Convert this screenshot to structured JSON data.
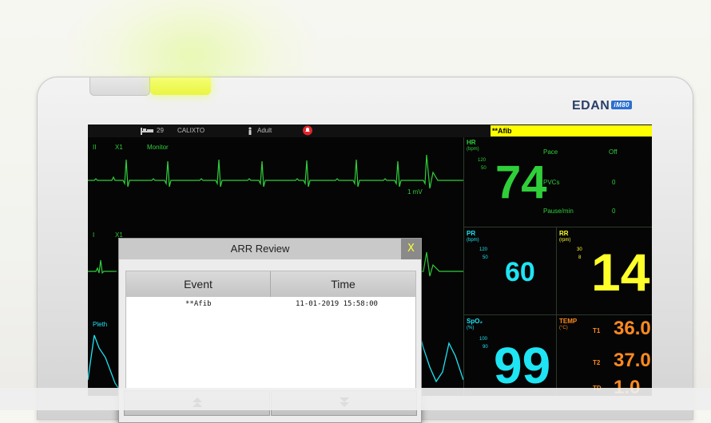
{
  "brand": {
    "name": "EDAN",
    "model": "iM80"
  },
  "topbar": {
    "bed_number": "29",
    "patient_name": "CALIXTO",
    "patient_type": "Adult",
    "alarm_text": "**Afib"
  },
  "waves": {
    "ecg1_lead": "II",
    "ecg1_gain": "X1",
    "ecg1_mode": "Monitor",
    "ecg1_scale": "1 mV",
    "ecg2_lead": "I",
    "ecg2_gain": "X1",
    "pleth_label": "Pleth"
  },
  "hr": {
    "label": "HR",
    "unit": "(bpm)",
    "limit_high": "120",
    "limit_low": "50",
    "value": "74",
    "pace_label": "Pace",
    "pace_value": "Off",
    "pvcs_label": "PVCs",
    "pvcs_value": "0",
    "pause_label": "Pause/min",
    "pause_value": "0"
  },
  "pr": {
    "label": "PR",
    "unit": "(bpm)",
    "limit_high": "120",
    "limit_low": "50",
    "value": "60"
  },
  "rr": {
    "label": "RR",
    "unit": "(rpm)",
    "limit_high": "30",
    "limit_low": "8",
    "value": "14"
  },
  "spo2": {
    "label": "SpO₂",
    "unit": "(%)",
    "limit_high": "100",
    "limit_low": "90",
    "value": "99"
  },
  "temp": {
    "label": "TEMP",
    "unit": "(°C)",
    "t1_label": "T1",
    "t1_value": "36.0",
    "t2_label": "T2",
    "t2_value": "37.0",
    "td_label": "TD",
    "td_value": "1.0"
  },
  "dialog": {
    "title": "ARR Review",
    "close_label": "X",
    "columns": [
      "Event",
      "Time"
    ],
    "rows": [
      {
        "event": "**Afib",
        "time": "11-01-2019 15:58:00"
      }
    ],
    "page_up_icon": "double-up-arrow",
    "page_down_icon": "double-down-arrow"
  },
  "colors": {
    "ecg": "#2fcf3a",
    "spo2": "#1ee4f3",
    "resp": "#ffff2a",
    "temp": "#ff8a1f",
    "alarm": "#ffff00"
  }
}
